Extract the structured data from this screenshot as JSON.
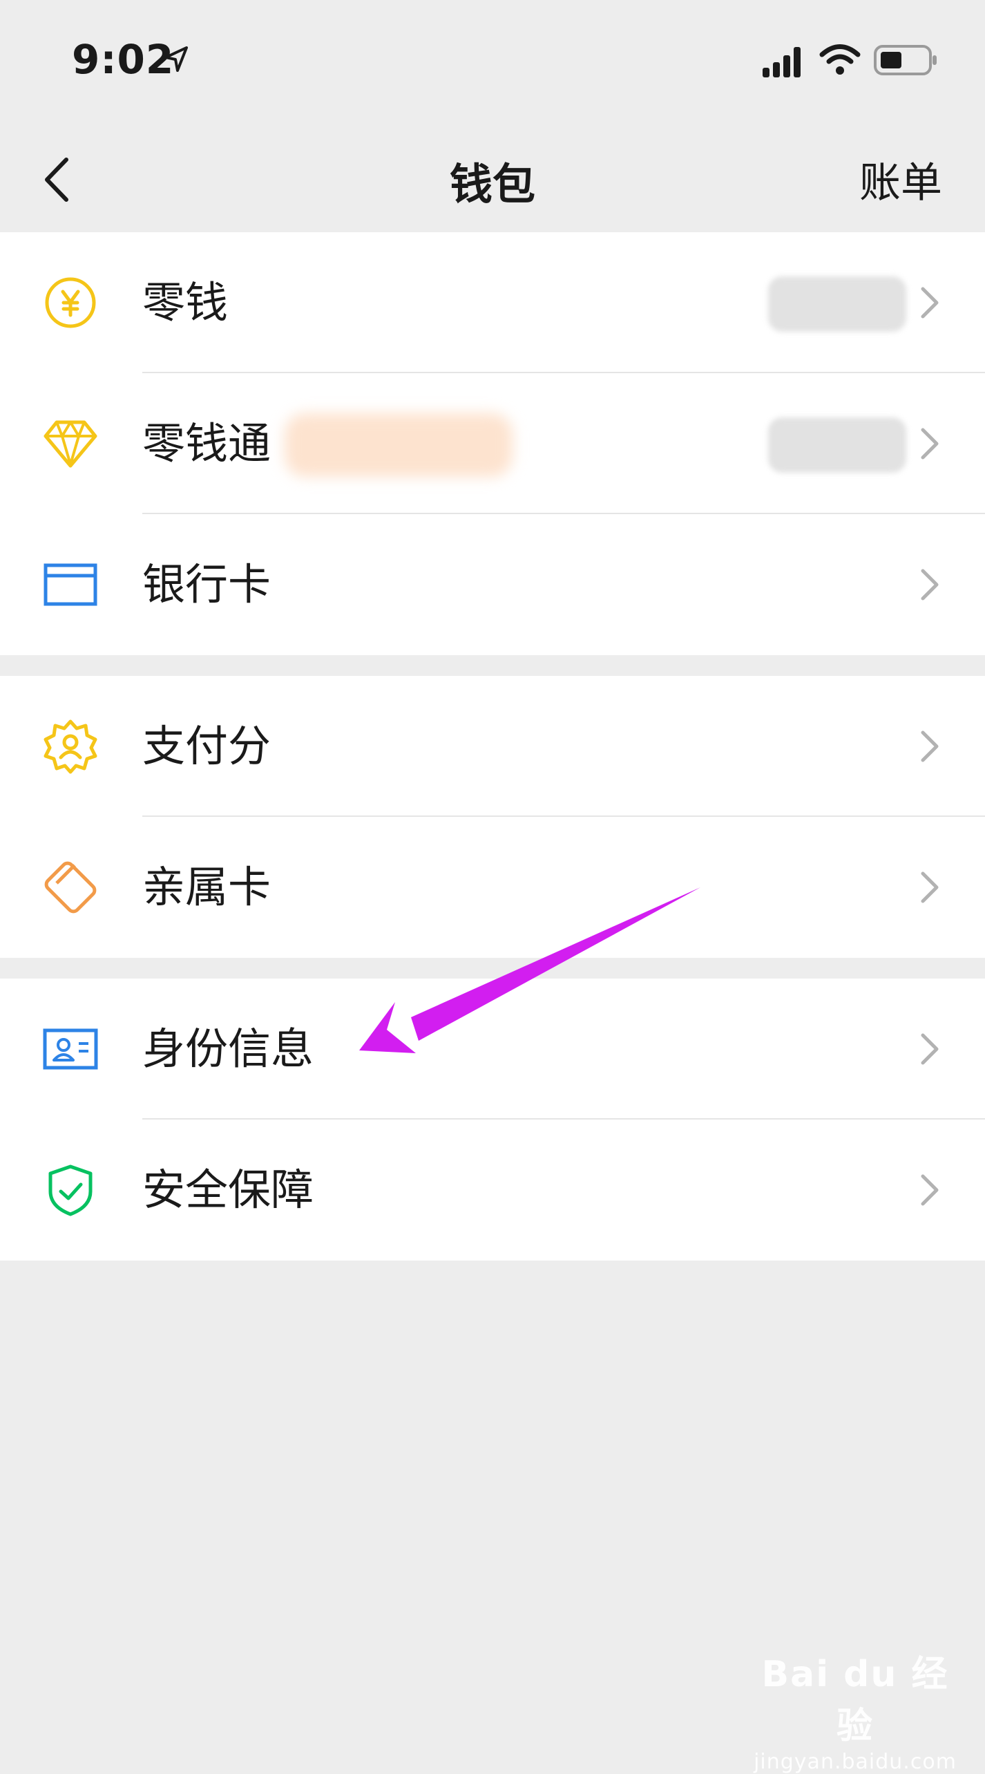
{
  "status_bar": {
    "time": "9:02",
    "location_icon": "location-arrow-icon",
    "signal_icon": "cellular-signal-icon",
    "wifi_icon": "wifi-icon",
    "battery_icon": "battery-icon"
  },
  "nav": {
    "back_icon": "chevron-left-icon",
    "title": "钱包",
    "bill_label": "账单"
  },
  "groups": [
    {
      "items": [
        {
          "label": "零钱",
          "icon": "yuan-coin-icon",
          "value_hidden": true
        },
        {
          "label": "零钱通",
          "icon": "diamond-icon",
          "value_hidden": true,
          "promo_hidden": true
        },
        {
          "label": "银行卡",
          "icon": "bank-card-icon"
        }
      ]
    },
    {
      "items": [
        {
          "label": "支付分",
          "icon": "pay-score-badge-icon"
        },
        {
          "label": "亲属卡",
          "icon": "family-card-icon"
        }
      ]
    },
    {
      "items": [
        {
          "label": "身份信息",
          "icon": "id-card-icon"
        },
        {
          "label": "安全保障",
          "icon": "shield-check-icon"
        }
      ]
    }
  ],
  "annotation": {
    "arrow_color": "#d21ef0",
    "points_to": "身份信息"
  },
  "watermark": {
    "logo": "Bai du 经验",
    "url": "jingyan.baidu.com"
  },
  "colors": {
    "background": "#ededed",
    "yellow": "#f5c518",
    "blue": "#2d83e6",
    "orange": "#f29b49",
    "green": "#07c160",
    "chevron": "#b2b2b2"
  }
}
